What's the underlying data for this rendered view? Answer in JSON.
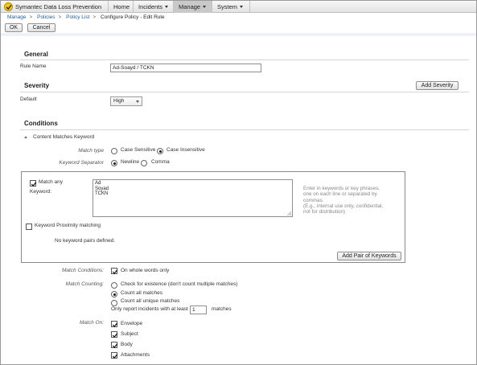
{
  "app": {
    "brand": "Symantec Data Loss Prevention",
    "nav": [
      {
        "label": "Home"
      },
      {
        "label": "Incidents"
      },
      {
        "label": "Manage"
      },
      {
        "label": "System"
      }
    ]
  },
  "breadcrumb": [
    "Manage",
    "Policies",
    "Policy List",
    "Configure Policy - Edit Rule"
  ],
  "actions": {
    "ok": "OK",
    "cancel": "Cancel"
  },
  "general": {
    "title": "General",
    "rule_name_label": "Rule Name",
    "rule_name_value": "Ad-Soayd / TCKN"
  },
  "severity": {
    "title": "Severity",
    "add_button": "Add Severity",
    "default_label": "Default",
    "default_value": "High"
  },
  "conditions": {
    "title": "Conditions",
    "condition_name": "Content Matches Keyword",
    "match_type": {
      "label": "Match type",
      "options": [
        "Case Sensitive",
        "Case Insensitive"
      ],
      "selected": "Case Insensitive"
    },
    "separator": {
      "label": "Keyword Separator",
      "options": [
        "Newline",
        "Comma"
      ],
      "selected": "Newline"
    },
    "keywords": {
      "match_any_label": "Match any",
      "match_any_checked": true,
      "keyword_label": "Keyword:",
      "value": [
        "Ad",
        "Soyad",
        "TCKN"
      ],
      "hint": [
        "Enter in keywords or key phrases,",
        "one on each line or separated by",
        "commas.",
        "(E.g., internal use only, confidential,",
        "not for distribution)"
      ]
    },
    "proximity": {
      "label": "Keyword Proximity matching",
      "checked": false,
      "empty_text": "No keyword pairs defined.",
      "add_button": "Add Pair of Keywords"
    },
    "match_conditions": {
      "label": "Match Conditions:",
      "option": "On whole words only",
      "checked": true
    },
    "match_counting": {
      "label": "Match Counting:",
      "options": [
        "Check for existence (don't count multiple matches)",
        "Count all matches",
        "Count all unique matches"
      ],
      "selected": "Count all matches",
      "threshold_prefix": "Only report incidents with at least",
      "threshold_value": "1",
      "threshold_suffix": "matches"
    },
    "match_on": {
      "label": "Match On:",
      "items": [
        {
          "label": "Envelope",
          "checked": true
        },
        {
          "label": "Subject",
          "checked": true
        },
        {
          "label": "Body",
          "checked": true
        },
        {
          "label": "Attachments",
          "checked": true
        }
      ]
    }
  }
}
